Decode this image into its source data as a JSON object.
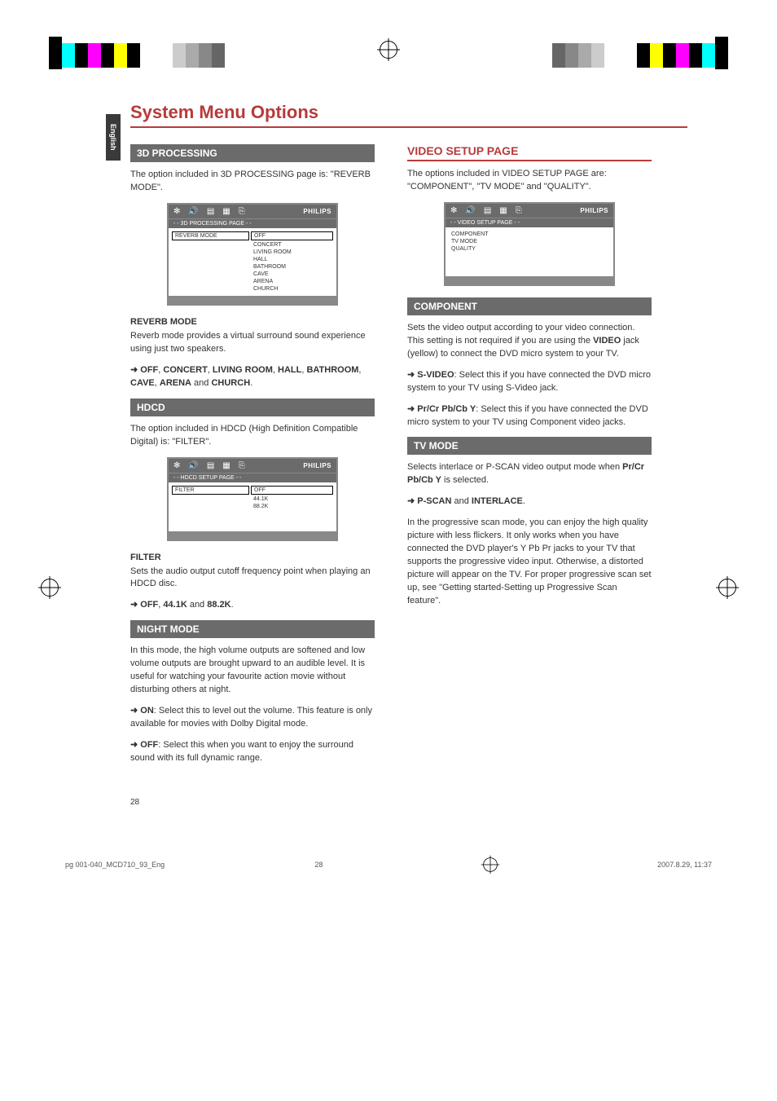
{
  "sideTab": "English",
  "title": "System Menu Options",
  "left": {
    "h_3d": "3D PROCESSING",
    "p_3d_intro": "The option included in 3D PROCESSING page is: \"REVERB MODE\".",
    "osd1": {
      "brand": "PHILIPS",
      "crumb": "- - 3D PROCESSING PAGE - -",
      "leftSel": "REVERB MODE",
      "rightSel": "OFF",
      "opts": [
        "CONCERT",
        "LIVING ROOM",
        "HALL",
        "BATHROOM",
        "CAVE",
        "ARENA",
        "CHURCH"
      ]
    },
    "h_reverb": "REVERB MODE",
    "p_reverb": "Reverb mode provides a virtual surround sound experience using just two speakers.",
    "reverb_line_pre": "➜ ",
    "reverb_line_a": "OFF",
    "reverb_line_b": "CONCERT",
    "reverb_line_c": "LIVING ROOM",
    "reverb_line_d": "HALL",
    "reverb_line_e": "BATHROOM",
    "reverb_line_f": "CAVE",
    "reverb_line_g": "ARENA",
    "reverb_line_h": "CHURCH",
    "reverb_and": " and ",
    "h_hdcd": "HDCD",
    "p_hdcd": "The option included in HDCD (High Definition Compatible Digital) is: \"FILTER\".",
    "osd2": {
      "brand": "PHILIPS",
      "crumb": "- - HDCD SETUP PAGE - -",
      "leftSel": "FILTER",
      "rightSel": "OFF",
      "opts": [
        "44.1K",
        "88.2K"
      ]
    },
    "h_filter": "FILTER",
    "p_filter": "Sets the audio output cutoff frequency point when playing an HDCD disc.",
    "filter_line_pre": "➜ ",
    "filter_a": "OFF",
    "filter_b": "44.1K",
    "filter_c": "88.2K",
    "filter_and": " and ",
    "h_night": "NIGHT MODE",
    "p_night1": "In this mode, the high volume outputs are softened and low volume outputs are brought upward to an audible level. It is useful for watching your favourite action movie without disturbing others at night.",
    "night_on_pre": "➜ ",
    "night_on_b": "ON",
    "night_on_rest": ": Select this to level out the volume. This feature is only available for movies with Dolby Digital mode.",
    "night_off_pre": "➜ ",
    "night_off_b": "OFF",
    "night_off_rest": ": Select this when you want to enjoy the surround sound with its full dynamic range."
  },
  "right": {
    "h_video": "VIDEO SETUP PAGE",
    "p_video_intro": "The options included in VIDEO SETUP PAGE are: \"COMPONENT\", \"TV MODE\" and \"QUALITY\".",
    "osd3": {
      "brand": "PHILIPS",
      "crumb": "- - VIDEO SETUP PAGE - -",
      "items": [
        "COMPONENT",
        "TV MODE",
        "QUALITY"
      ]
    },
    "h_component": "COMPONENT",
    "p_component_a": "Sets the video output according to your video connection. This setting is not required if you are using the ",
    "p_component_b": "VIDEO",
    "p_component_c": " jack (yellow) to connect the DVD micro system to your TV.",
    "sv_pre": "➜ ",
    "sv_b": "S-VIDEO",
    "sv_rest": ": Select this if you have connected the DVD micro system to your TV using S-Video jack.",
    "pr_pre": "➜ ",
    "pr_b": "Pr/Cr Pb/Cb Y",
    "pr_rest": ": Select this if you have connected the DVD micro system to your TV using Component video jacks.",
    "h_tvmode": "TV MODE",
    "p_tvmode_a": "Selects interlace or P-SCAN video output mode when ",
    "p_tvmode_b": "Pr/Cr Pb/Cb Y",
    "p_tvmode_c": " is selected.",
    "tv_line_pre": "➜ ",
    "tv_a": "P-SCAN",
    "tv_and": " and ",
    "tv_b": "INTERLACE",
    "p_tv_note": "In the progressive scan mode, you can enjoy the high quality picture with less flickers. It only works when you have connected the DVD player's Y Pb Pr jacks to your TV that supports the progressive video input. Otherwise, a distorted picture will appear on the TV. For proper progressive scan set up, see \"Getting started-Setting up Progressive Scan feature\"."
  },
  "pageNumber": "28",
  "footer": {
    "file": "pg 001-040_MCD710_93_Eng",
    "page": "28",
    "date": "2007.8.29, 11:37"
  }
}
